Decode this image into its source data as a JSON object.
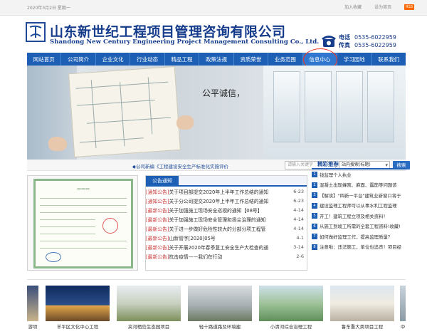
{
  "topbar": {
    "date": "2020年3月2日 星期一",
    "favorite": "加入收藏",
    "homepage": "设为首页",
    "rss": "RSS"
  },
  "header": {
    "company_cn": "山东新世纪工程项目管理咨询有限公司",
    "company_en": "Shandong New Century Engineering Project Management Consulting Co., Ltd.",
    "phone_label": "电话",
    "phone": "0535-6022959",
    "fax_label": "传真",
    "fax": "0535-6022959"
  },
  "nav": [
    {
      "label": "网站首页"
    },
    {
      "label": "公司简介"
    },
    {
      "label": "企业文化"
    },
    {
      "label": "行业动态"
    },
    {
      "label": "精品工程"
    },
    {
      "label": "政策法规"
    },
    {
      "label": "资质荣誉"
    },
    {
      "label": "业务范围"
    },
    {
      "label": "信息中心"
    },
    {
      "label": "学习园地"
    },
    {
      "label": "联系我们"
    }
  ],
  "banner": {
    "slogan": "公平诚信，"
  },
  "ticker": {
    "notice": "◆公司新编《工程建设安全生产标准化实施评价",
    "search_placeholder": "请输入关键字",
    "search_scope": "站内搜索(标题)",
    "search_button": "搜索"
  },
  "notices": {
    "title": "公告通知",
    "items": [
      {
        "tag": "[通知公告]",
        "title": "关于项目部提交2020年上半年工作总结的通知",
        "date": "6-23"
      },
      {
        "tag": "[通知公告]",
        "title": "关于分公司提交2020年上半年工作总结的通知",
        "date": "6-23"
      },
      {
        "tag": "[最新公告]",
        "title": "关于加强施工现场安全巡视的通知【08号】",
        "date": "4-14"
      },
      {
        "tag": "[最新公告]",
        "title": "关于加强施工现场安全管理和扬尘治理的通知",
        "date": "4-14"
      },
      {
        "tag": "[最新公告]",
        "title": "关于进一步做好危险性较大的分部分项工程管",
        "date": "4-14"
      },
      {
        "tag": "[最新公告]",
        "title": "山新管字[2020]05号",
        "date": "4-1"
      },
      {
        "tag": "[最新公告]",
        "title": "关于开展2020年春季复工安全生产大检查的通",
        "date": "3-14"
      },
      {
        "tag": "[最新公告]",
        "title": "抗击疫情——我们在行动",
        "date": "2-6"
      }
    ]
  },
  "recommend": {
    "title": "精彩推荐",
    "items": [
      {
        "num": "1",
        "text": "钱监理个人执业"
      },
      {
        "num": "2",
        "text": "混凝土出现蜂窝、麻面、露筋等问题该"
      },
      {
        "num": "3",
        "text": "【解读】\"四新一平台\"建筑业新窗口将于"
      },
      {
        "num": "4",
        "text": "建设监理工程师可以从事水利工程监理"
      },
      {
        "num": "5",
        "text": "开工！建筑工程立项及相关资料！"
      },
      {
        "num": "6",
        "text": "从施工到竣工所需的全套工程资料!收藏!"
      },
      {
        "num": "7",
        "text": "如何做好监理工作，提高监理质量？"
      },
      {
        "num": "8",
        "text": "注意啦：违法施工，单位也追责！项目经"
      }
    ]
  },
  "projects": [
    {
      "caption": "游项"
    },
    {
      "caption": "羊平区文化中心工程"
    },
    {
      "caption": "夹河栖岛生态园项目"
    },
    {
      "caption": "轻十路道路及环境建"
    },
    {
      "caption": "小清河综合治理工程"
    },
    {
      "caption": "鲁东重大类项目工程"
    },
    {
      "caption": "中"
    }
  ],
  "colors": {
    "brand_blue": "#163c8c",
    "nav_blue": "#1c5fb5",
    "notice_red": "#c33",
    "highlight_circle": "#e32"
  }
}
